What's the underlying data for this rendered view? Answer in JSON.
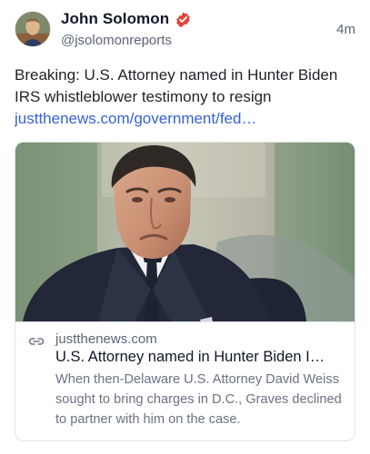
{
  "post": {
    "author": {
      "display_name": "John Solomon",
      "handle": "@jsolomonreports",
      "verified_icon": "verified-badge-icon",
      "avatar": "author-avatar"
    },
    "time_ago": "4m",
    "text": "Breaking: U.S. Attorney named in Hunter Biden IRS whistleblower testimony to resign",
    "link_text": "justthenews.com/government/fed…"
  },
  "link_card": {
    "image": "news-photo",
    "link_icon": "link-icon",
    "domain": "justthenews.com",
    "title": "U.S. Attorney named in Hunter Biden I…",
    "description": "When then-Delaware U.S. Attorney David Weiss sought to bring charges in D.C., Graves declined to partner with him on the case."
  },
  "colors": {
    "accent_link": "#3562d6",
    "verified": "#e0443b",
    "muted_text": "#5b6573"
  }
}
